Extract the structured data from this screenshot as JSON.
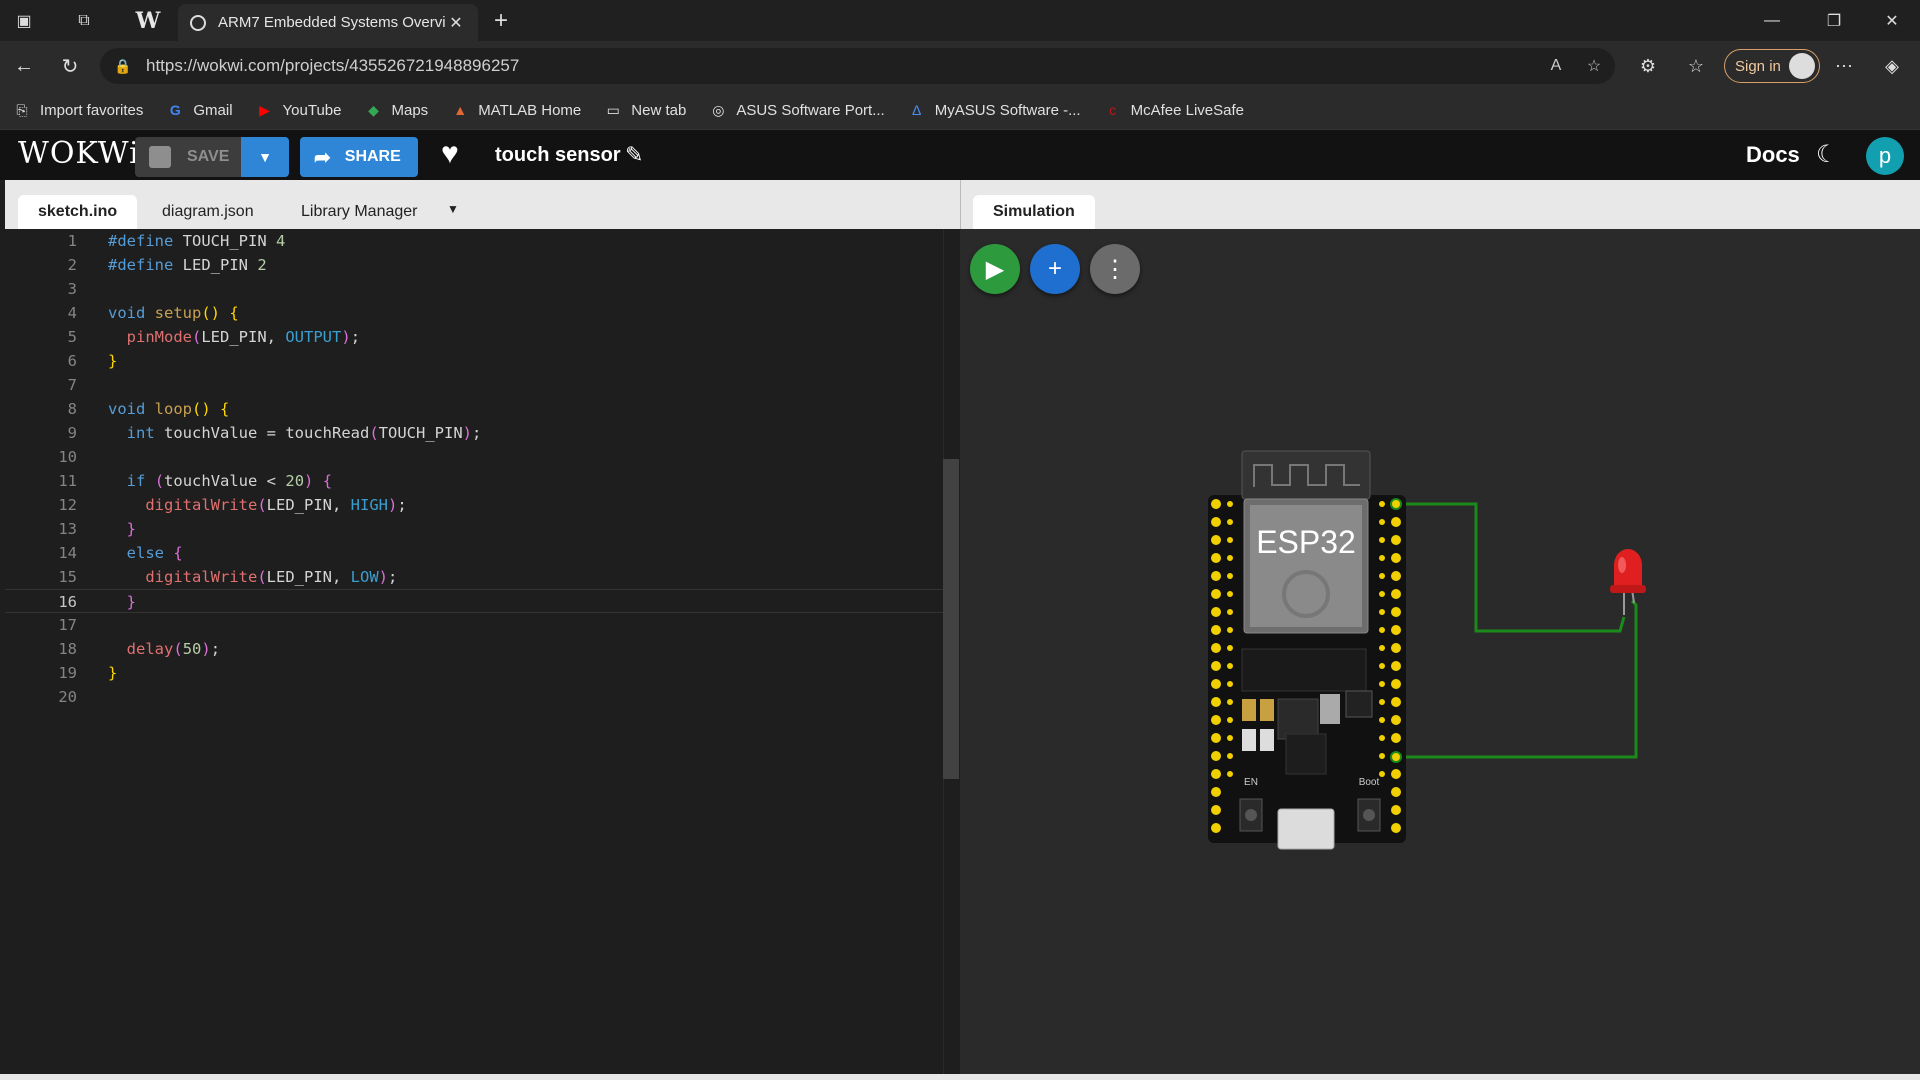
{
  "browser": {
    "tab_title": "ARM7 Embedded Systems Overvi",
    "url": "https://wokwi.com/projects/435526721948896257",
    "signin_label": "Sign in",
    "bookmarks": [
      {
        "label": "Import favorites",
        "icon": "import-icon"
      },
      {
        "label": "Gmail",
        "icon": "google-icon"
      },
      {
        "label": "YouTube",
        "icon": "youtube-icon"
      },
      {
        "label": "Maps",
        "icon": "maps-icon"
      },
      {
        "label": "MATLAB Home",
        "icon": "matlab-icon"
      },
      {
        "label": "New tab",
        "icon": "newtab-icon"
      },
      {
        "label": "ASUS Software Port...",
        "icon": "globe-icon"
      },
      {
        "label": "MyASUS Software -...",
        "icon": "myasus-icon"
      },
      {
        "label": "McAfee LiveSafe",
        "icon": "mcafee-icon"
      }
    ]
  },
  "wokwi": {
    "logo": "WOKWi",
    "save_label": "SAVE",
    "share_label": "SHARE",
    "project_name": "touch sensor",
    "docs_label": "Docs",
    "avatar_letter": "p"
  },
  "editor": {
    "tabs": [
      "sketch.ino",
      "diagram.json",
      "Library Manager"
    ],
    "current_line": 16
  },
  "simulation": {
    "tab_label": "Simulation",
    "board_label": "ESP32",
    "en_label": "EN",
    "boot_label": "Boot",
    "colors": {
      "play": "#2e9a3e",
      "add": "#1e6fd0",
      "more": "#6b6b6b",
      "wire": "#1a8a1a",
      "led": "#e02020"
    }
  }
}
